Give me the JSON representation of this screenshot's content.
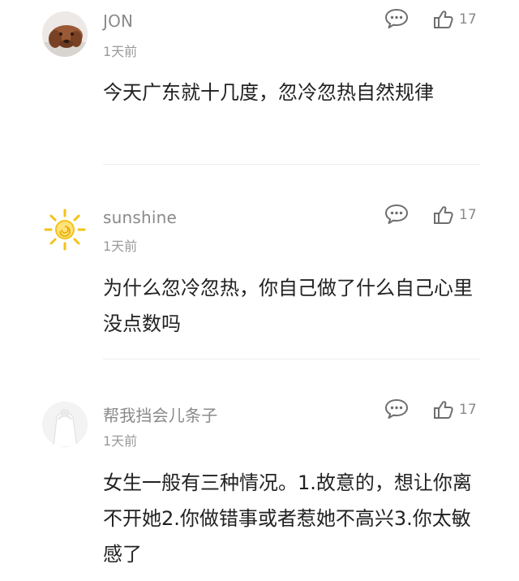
{
  "comments": [
    {
      "username": "JON",
      "time": "1天前",
      "content": "今天广东就十几度，忽冷忽热自然规律",
      "likes": "17",
      "avatar": "dog-avatar-icon"
    },
    {
      "username": "sunshine",
      "time": "1天前",
      "content": "为什么忽冷忽热，你自己做了什么自己心里没点数吗",
      "likes": "17",
      "avatar": "sun-avatar-icon"
    },
    {
      "username": "帮我挡会儿条子",
      "time": "1天前",
      "content": "女生一般有三种情况。1.故意的，想让你离不开她2.你做错事或者惹她不高兴3.你太敏感了",
      "likes": "17",
      "avatar": "figure-avatar-icon"
    }
  ],
  "colors": {
    "username": "#8a8a8a",
    "content": "#222222",
    "icon": "#6e6e6e",
    "sun": "#f3c21a"
  }
}
